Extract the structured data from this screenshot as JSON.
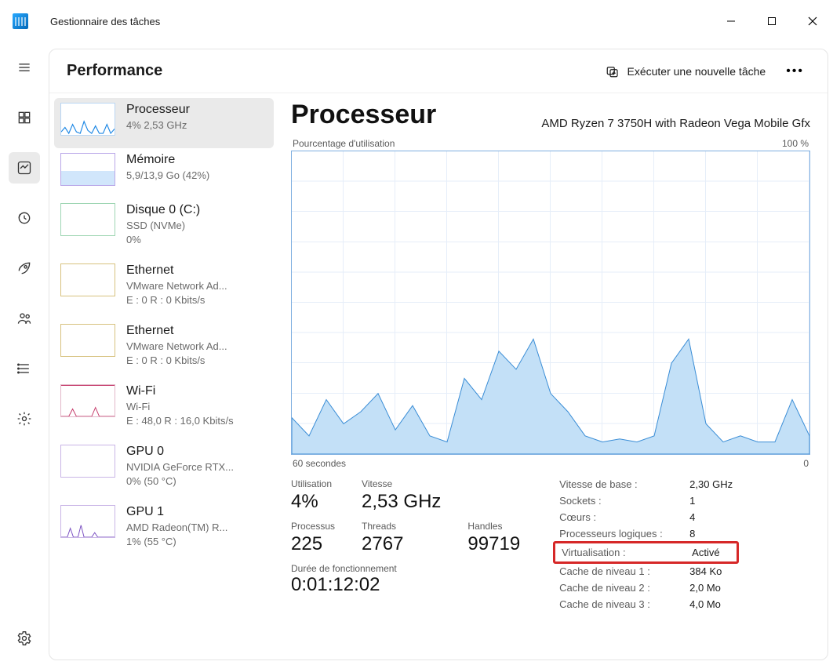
{
  "app": {
    "title": "Gestionnaire des tâches"
  },
  "header": {
    "page_title": "Performance",
    "run_task": "Exécuter une nouvelle tâche"
  },
  "sidebar": {
    "items": [
      {
        "title": "Processeur",
        "sub": "4%  2,53 GHz"
      },
      {
        "title": "Mémoire",
        "sub": "5,9/13,9 Go (42%)"
      },
      {
        "title": "Disque 0 (C:)",
        "sub": "SSD (NVMe)\n0%"
      },
      {
        "title": "Ethernet",
        "sub": "VMware Network Ad...\nE : 0 R : 0 Kbits/s"
      },
      {
        "title": "Ethernet",
        "sub": "VMware Network Ad...\nE : 0 R : 0 Kbits/s"
      },
      {
        "title": "Wi-Fi",
        "sub": "Wi-Fi\nE : 48,0 R : 16,0 Kbits/s"
      },
      {
        "title": "GPU 0",
        "sub": "NVIDIA GeForce RTX...\n0%  (50 °C)"
      },
      {
        "title": "GPU 1",
        "sub": "AMD Radeon(TM) R...\n1%  (55 °C)"
      }
    ]
  },
  "content": {
    "heading": "Processeur",
    "model": "AMD Ryzen 7 3750H with Radeon Vega Mobile Gfx",
    "chart_label_left": "Pourcentage d'utilisation",
    "chart_label_right": "100 %",
    "x_axis_left": "60 secondes",
    "x_axis_right": "0",
    "stats": {
      "util_label": "Utilisation",
      "util_value": "4%",
      "speed_label": "Vitesse",
      "speed_value": "2,53 GHz",
      "proc_label": "Processus",
      "proc_value": "225",
      "threads_label": "Threads",
      "threads_value": "2767",
      "handles_label": "Handles",
      "handles_value": "99719"
    },
    "uptime_label": "Durée de fonctionnement",
    "uptime_value": "0:01:12:02",
    "right_stats": [
      {
        "k": "Vitesse de base :",
        "v": "2,30 GHz"
      },
      {
        "k": "Sockets :",
        "v": "1"
      },
      {
        "k": "Cœurs :",
        "v": "4"
      },
      {
        "k": "Processeurs logiques :",
        "v": "8"
      },
      {
        "k": "Virtualisation :",
        "v": "Activé",
        "highlight": true
      },
      {
        "k": "Cache de niveau 1 :",
        "v": "384 Ko"
      },
      {
        "k": "Cache de niveau 2 :",
        "v": "2,0 Mo"
      },
      {
        "k": "Cache de niveau 3 :",
        "v": "4,0 Mo"
      }
    ]
  },
  "chart_data": {
    "type": "area",
    "xlabel": "60 secondes → 0",
    "ylabel": "Pourcentage d'utilisation",
    "ylim": [
      0,
      100
    ],
    "x": [
      0,
      2,
      4,
      6,
      8,
      10,
      12,
      14,
      16,
      18,
      20,
      22,
      24,
      26,
      28,
      30,
      32,
      34,
      36,
      38,
      40,
      42,
      44,
      46,
      48,
      50,
      52,
      54,
      56,
      58,
      60
    ],
    "values": [
      12,
      6,
      18,
      10,
      14,
      20,
      8,
      16,
      6,
      4,
      25,
      18,
      34,
      28,
      38,
      20,
      14,
      6,
      4,
      5,
      4,
      6,
      30,
      38,
      10,
      4,
      6,
      4,
      4,
      18,
      6
    ]
  }
}
